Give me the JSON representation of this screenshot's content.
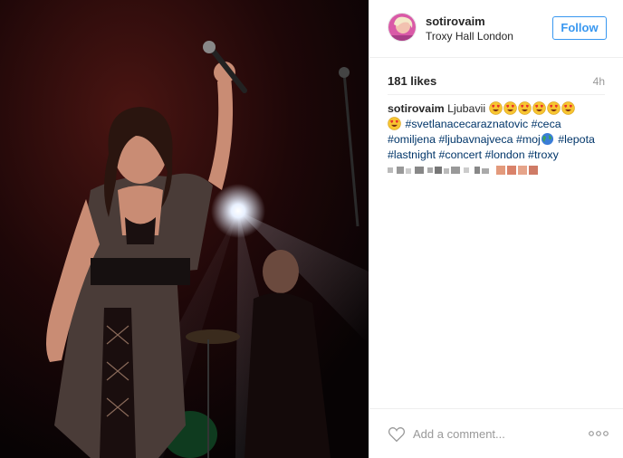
{
  "post": {
    "username": "sotirovaim",
    "location": "Troxy Hall London",
    "follow_label": "Follow",
    "likes": "181 likes",
    "time": "4h"
  },
  "caption": {
    "username": "sotirovaim",
    "text": "Ljubavii",
    "emoji_name": "heart-eyes-emoji",
    "emoji_count_line1": 6,
    "emoji_count_line2": 1,
    "tags": [
      "#svetlanacecaraznatovic",
      "#ceca",
      "#omiljena",
      "#ljubavnajveca",
      "#moj",
      "#lepota",
      "#lastnight",
      "#concert",
      "#london",
      "#troxy"
    ]
  },
  "comment_box": {
    "placeholder": "Add a comment..."
  },
  "colors": {
    "accent": "#3897f0",
    "hashtag": "#003569",
    "emoji_face": "#f7c531",
    "emoji_heart": "#e8322c"
  }
}
